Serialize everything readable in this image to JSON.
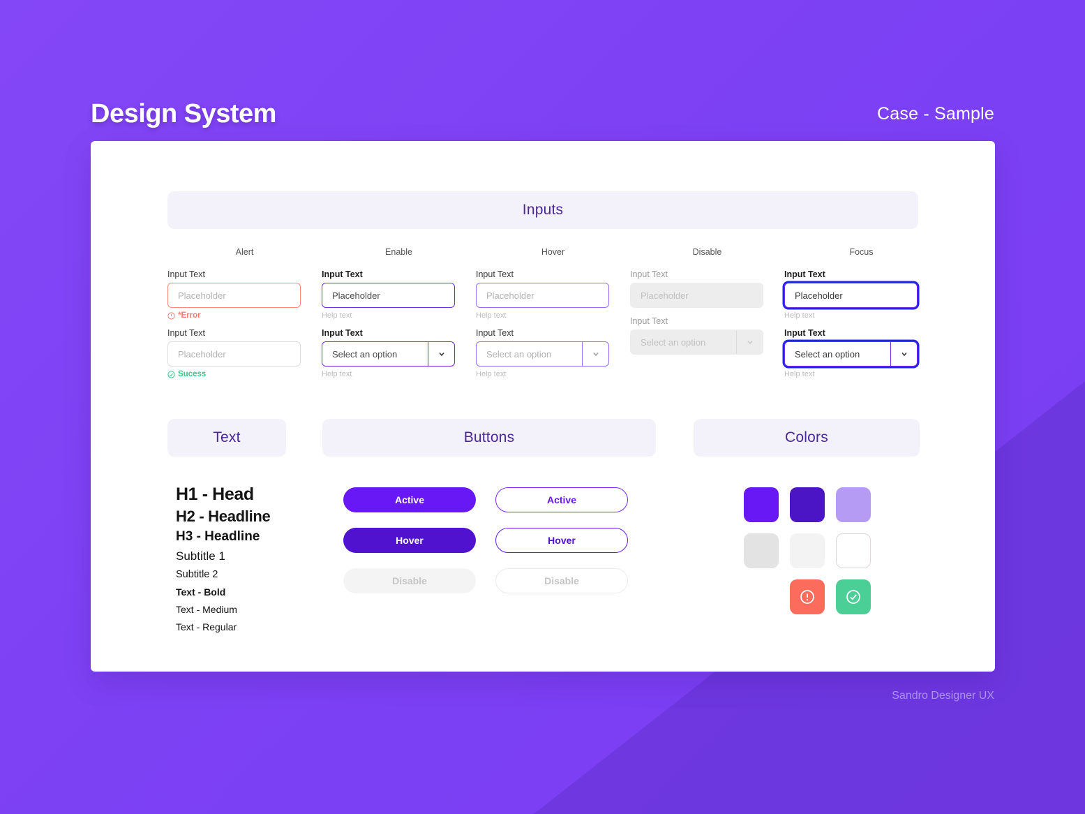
{
  "header": {
    "title": "Design System",
    "case_label": "Case - Sample"
  },
  "sections": {
    "inputs_title": "Inputs",
    "text_title": "Text",
    "buttons_title": "Buttons",
    "colors_title": "Colors"
  },
  "inputs": {
    "column_labels": [
      "Alert",
      "Enable",
      "Hover",
      "Disable",
      "Focus"
    ],
    "field_label": "Input Text",
    "placeholder": "Placeholder",
    "select_placeholder": "Select an option",
    "help_text": "Help text",
    "error_message": "*Error",
    "success_message": "Sucess",
    "chevron_glyph": "⌄"
  },
  "typography": {
    "items": [
      "H1 - Head",
      "H2 - Headline",
      "H3 - Headline",
      "Subtitle 1",
      "Subtitle 2",
      "Text - Bold",
      "Text - Medium",
      "Text - Regular"
    ]
  },
  "buttons": {
    "filled": [
      {
        "label": "Active",
        "state": "active"
      },
      {
        "label": "Hover",
        "state": "hover"
      },
      {
        "label": "Disable",
        "state": "disabled"
      }
    ],
    "outlined": [
      {
        "label": "Active",
        "state": "active"
      },
      {
        "label": "Hover",
        "state": "hover"
      },
      {
        "label": "Disable",
        "state": "disabled"
      }
    ]
  },
  "colors": {
    "swatches": [
      {
        "name": "primary-purple",
        "hex": "#6818F5"
      },
      {
        "name": "dark-purple",
        "hex": "#4B14C4"
      },
      {
        "name": "light-purple",
        "hex": "#B69BF5"
      },
      {
        "name": "gray",
        "hex": "#E3E3E3"
      },
      {
        "name": "light-gray",
        "hex": "#F3F3F3"
      },
      {
        "name": "white",
        "hex": "#FFFFFF"
      },
      {
        "name": "error-red",
        "hex": "#FB6C5C"
      },
      {
        "name": "success-green",
        "hex": "#4ACF96"
      }
    ]
  },
  "footer": {
    "credit": "Sandro Designer UX"
  },
  "theme": {
    "background": "#8044F5",
    "card_background": "#FFFFFF",
    "pill_background": "#F3F1FA",
    "pill_text": "#4A2896",
    "focus_ring": "#2323EF"
  }
}
